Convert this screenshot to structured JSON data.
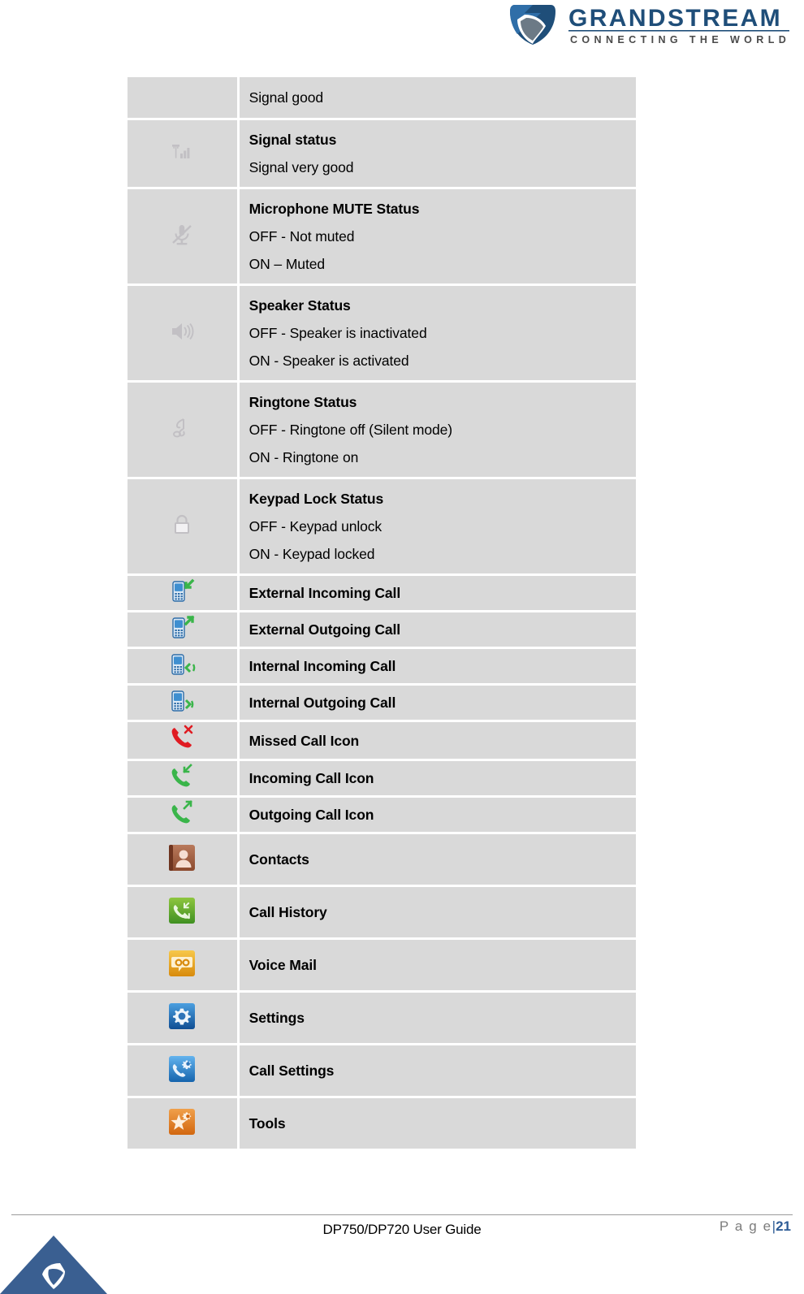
{
  "header": {
    "brand_name": "GRANDSTREAM",
    "brand_tagline": "CONNECTING THE WORLD",
    "brand_color": "#1f4e79"
  },
  "table": {
    "rows": [
      {
        "icon": "none",
        "lines": [
          {
            "text": "Signal good",
            "bold": false
          }
        ]
      },
      {
        "icon": "signal-bars-icon",
        "lines": [
          {
            "text": "Signal status",
            "bold": true
          },
          {
            "text": "Signal very good",
            "bold": false
          }
        ]
      },
      {
        "icon": "microphone-mute-icon",
        "lines": [
          {
            "text": "Microphone MUTE Status",
            "bold": true
          },
          {
            "text": "OFF - Not muted",
            "bold": false
          },
          {
            "text": "ON – Muted",
            "bold": false
          }
        ]
      },
      {
        "icon": "speaker-icon",
        "lines": [
          {
            "text": "Speaker Status",
            "bold": true
          },
          {
            "text": "OFF - Speaker is inactivated",
            "bold": false
          },
          {
            "text": "ON - Speaker is activated",
            "bold": false
          }
        ]
      },
      {
        "icon": "music-note-icon",
        "lines": [
          {
            "text": "Ringtone Status",
            "bold": true
          },
          {
            "text": "OFF - Ringtone off (Silent mode)",
            "bold": false
          },
          {
            "text": "ON - Ringtone on",
            "bold": false
          }
        ]
      },
      {
        "icon": "padlock-icon",
        "lines": [
          {
            "text": "Keypad Lock Status",
            "bold": true
          },
          {
            "text": "OFF - Keypad unlock",
            "bold": false
          },
          {
            "text": "ON - Keypad locked",
            "bold": false
          }
        ]
      },
      {
        "icon": "handset-external-incoming-icon",
        "lines": [
          {
            "text": "External Incoming Call",
            "bold": true
          }
        ]
      },
      {
        "icon": "handset-external-outgoing-icon",
        "lines": [
          {
            "text": "External Outgoing Call",
            "bold": true
          }
        ]
      },
      {
        "icon": "handset-internal-incoming-icon",
        "lines": [
          {
            "text": "Internal Incoming Call",
            "bold": true
          }
        ]
      },
      {
        "icon": "handset-internal-outgoing-icon",
        "lines": [
          {
            "text": "Internal Outgoing Call",
            "bold": true
          }
        ]
      },
      {
        "icon": "missed-call-icon",
        "lines": [
          {
            "text": "Missed Call Icon",
            "bold": true
          }
        ]
      },
      {
        "icon": "incoming-call-icon",
        "lines": [
          {
            "text": "Incoming Call Icon",
            "bold": true
          }
        ]
      },
      {
        "icon": "outgoing-call-icon",
        "lines": [
          {
            "text": "Outgoing Call Icon",
            "bold": true
          }
        ]
      },
      {
        "icon": "contacts-app-icon",
        "lines": [
          {
            "text": "Contacts",
            "bold": true
          }
        ]
      },
      {
        "icon": "call-history-app-icon",
        "lines": [
          {
            "text": "Call History",
            "bold": true
          }
        ]
      },
      {
        "icon": "voice-mail-app-icon",
        "lines": [
          {
            "text": "Voice Mail",
            "bold": true
          }
        ]
      },
      {
        "icon": "settings-app-icon",
        "lines": [
          {
            "text": "Settings",
            "bold": true
          }
        ]
      },
      {
        "icon": "call-settings-app-icon",
        "lines": [
          {
            "text": "Call Settings",
            "bold": true
          }
        ]
      },
      {
        "icon": "tools-app-icon",
        "lines": [
          {
            "text": "Tools",
            "bold": true
          }
        ]
      }
    ]
  },
  "footer": {
    "document_title": "DP750/DP720 User Guide",
    "page_label": "P a g e",
    "page_separator": "|",
    "page_number": "21"
  },
  "colors": {
    "cell_background": "#d9d9d9",
    "cell_border": "#ffffff",
    "status_icon_gray": "#c2c0c4",
    "green": "#3ab54a",
    "red": "#e01b22",
    "contacts_brown": "#a05a3c",
    "voicemail_orange": "#e8a317",
    "settings_blue": "#1f6fc4",
    "tools_orange": "#e07b28",
    "footer_accent": "#2e5c96"
  }
}
